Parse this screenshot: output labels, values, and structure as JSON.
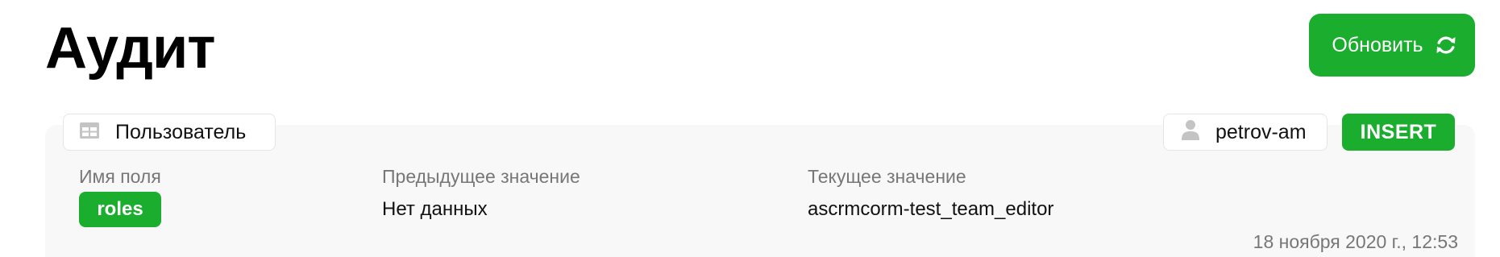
{
  "header": {
    "title": "Аудит",
    "refresh_label": "Обновить"
  },
  "audit_entry": {
    "entity": "Пользователь",
    "user": "petrov-am",
    "operation": "INSERT",
    "columns": {
      "field_name": "Имя поля",
      "previous_value": "Предыдущее значение",
      "current_value": "Текущее значение"
    },
    "row": {
      "field": "roles",
      "previous": "Нет данных",
      "current": "ascrmcorm-test_team_editor"
    },
    "timestamp": "18 ноября 2020 г., 12:53"
  },
  "colors": {
    "accent": "#1aad2e",
    "card_background": "#f8f8f8",
    "muted_text": "#777777"
  },
  "icons": {
    "refresh": "refresh-icon",
    "entity": "table-icon",
    "user": "user-icon"
  }
}
